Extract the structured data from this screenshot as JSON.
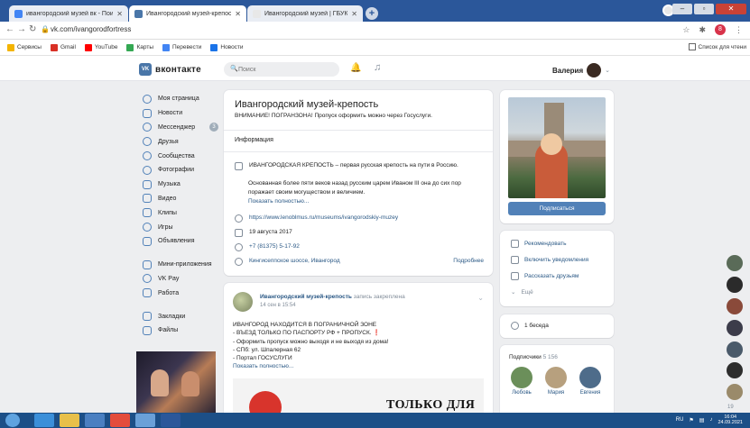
{
  "browser": {
    "tabs": [
      {
        "title": "ивангородский музей вк - Пои",
        "favicon_color": "#4285f4",
        "active": false
      },
      {
        "title": "Ивангородский музей-крепост",
        "favicon_color": "#4a76a8",
        "active": true
      },
      {
        "title": "Ивангородский музей | ГБУК Л",
        "favicon_color": "#e8e8e8",
        "active": false
      }
    ],
    "new_tab": "+",
    "url": "vk.com/ivangorodfortress",
    "bookmarks": [
      {
        "label": "Сервисы",
        "color": "#f4b400"
      },
      {
        "label": "Gmail",
        "color": "#d93025"
      },
      {
        "label": "YouTube",
        "color": "#ff0000"
      },
      {
        "label": "Карты",
        "color": "#34a853"
      },
      {
        "label": "Перевести",
        "color": "#4285f4"
      },
      {
        "label": "Новости",
        "color": "#1a73e8"
      }
    ],
    "reading_list": "Список для чтени",
    "extension_badge": "8"
  },
  "vk": {
    "logo": "вконтакте",
    "logo_mark": "VK",
    "search_placeholder": "Поиск",
    "user_name": "Валерия",
    "nav": [
      {
        "label": "Моя страница",
        "icon": "user-icon"
      },
      {
        "label": "Новости",
        "icon": "news-icon"
      },
      {
        "label": "Мессенджер",
        "icon": "chat-icon",
        "count": "3"
      },
      {
        "label": "Друзья",
        "icon": "friends-icon"
      },
      {
        "label": "Сообщества",
        "icon": "groups-icon"
      },
      {
        "label": "Фотографии",
        "icon": "photo-icon"
      },
      {
        "label": "Музыка",
        "icon": "music-icon"
      },
      {
        "label": "Видео",
        "icon": "video-icon"
      },
      {
        "label": "Клипы",
        "icon": "clips-icon"
      },
      {
        "label": "Игры",
        "icon": "games-icon"
      },
      {
        "label": "Объявления",
        "icon": "ads-icon"
      }
    ],
    "nav2": [
      {
        "label": "Мини-приложения",
        "icon": "apps-icon"
      },
      {
        "label": "VK Pay",
        "icon": "pay-icon"
      },
      {
        "label": "Работа",
        "icon": "work-icon"
      }
    ],
    "nav3": [
      {
        "label": "Закладки",
        "icon": "bookmark-icon"
      },
      {
        "label": "Файлы",
        "icon": "files-icon"
      }
    ]
  },
  "group": {
    "title": "Ивангородский музей-крепость",
    "status": "ВНИМАНИЕ! ПОГРАНЗОНА! Пропуск оформить можно через Госуслуги.",
    "info_tab": "Информация",
    "description_head": "ИВАНГОРОДСКАЯ КРЕПОСТЬ – первая русская крепость на пути в Россию.",
    "description_body": "Основанная более пяти веков назад русским царем Иваном III она до сих пор поражает своим могуществом и величием.",
    "show_more": "Показать полностью...",
    "website": "https://www.lenoblmus.ru/museums/ivangorodskiy-muzey",
    "date": "19 августа 2017",
    "phone": "+7 (81375) 5-17-92",
    "address": "Кингисеппское шоссе, Ивангород",
    "details_link": "Подробнее"
  },
  "post": {
    "author": "Ивангородский музей-крепость",
    "pinned": "запись закреплена",
    "date": "14 сен в 15:54",
    "lines": [
      "ИВАНГОРОД НАХОДИТСЯ В ПОГРАНИЧНОЙ ЗОНЕ",
      "- ВЪЕЗД ТОЛЬКО ПО ПАСПОРТУ РФ + ПРОПУСК. ❗",
      "- Оформить пропуск можно выходя и не выходя из дома!",
      "- СПб: ул. Шпалерная 62",
      "- Портал ГОСУСЛУГИ"
    ],
    "show_more": "Показать полностью...",
    "image_text": "ТОЛЬКО ДЛЯ"
  },
  "right": {
    "subscribe": "Подписаться",
    "actions": [
      {
        "label": "Рекомендовать",
        "icon": "like-icon"
      },
      {
        "label": "Включить уведомления",
        "icon": "bell-icon"
      },
      {
        "label": "Рассказать друзьям",
        "icon": "share-icon"
      },
      {
        "label": "Ещё",
        "icon": "chevron-down-icon"
      }
    ],
    "discussions": "1 беседа",
    "subscribers_label": "Подписчики",
    "subscribers_count": "5 156",
    "followers": [
      {
        "name": "Любовь",
        "color": "#6b8f5a"
      },
      {
        "name": "Мария",
        "color": "#b7a07e"
      },
      {
        "name": "Евгения",
        "color": "#4e6c8a"
      }
    ]
  },
  "side_counter": "19",
  "taskbar": {
    "lang": "RU",
    "time": "16:04",
    "date": "24.09.2021"
  }
}
